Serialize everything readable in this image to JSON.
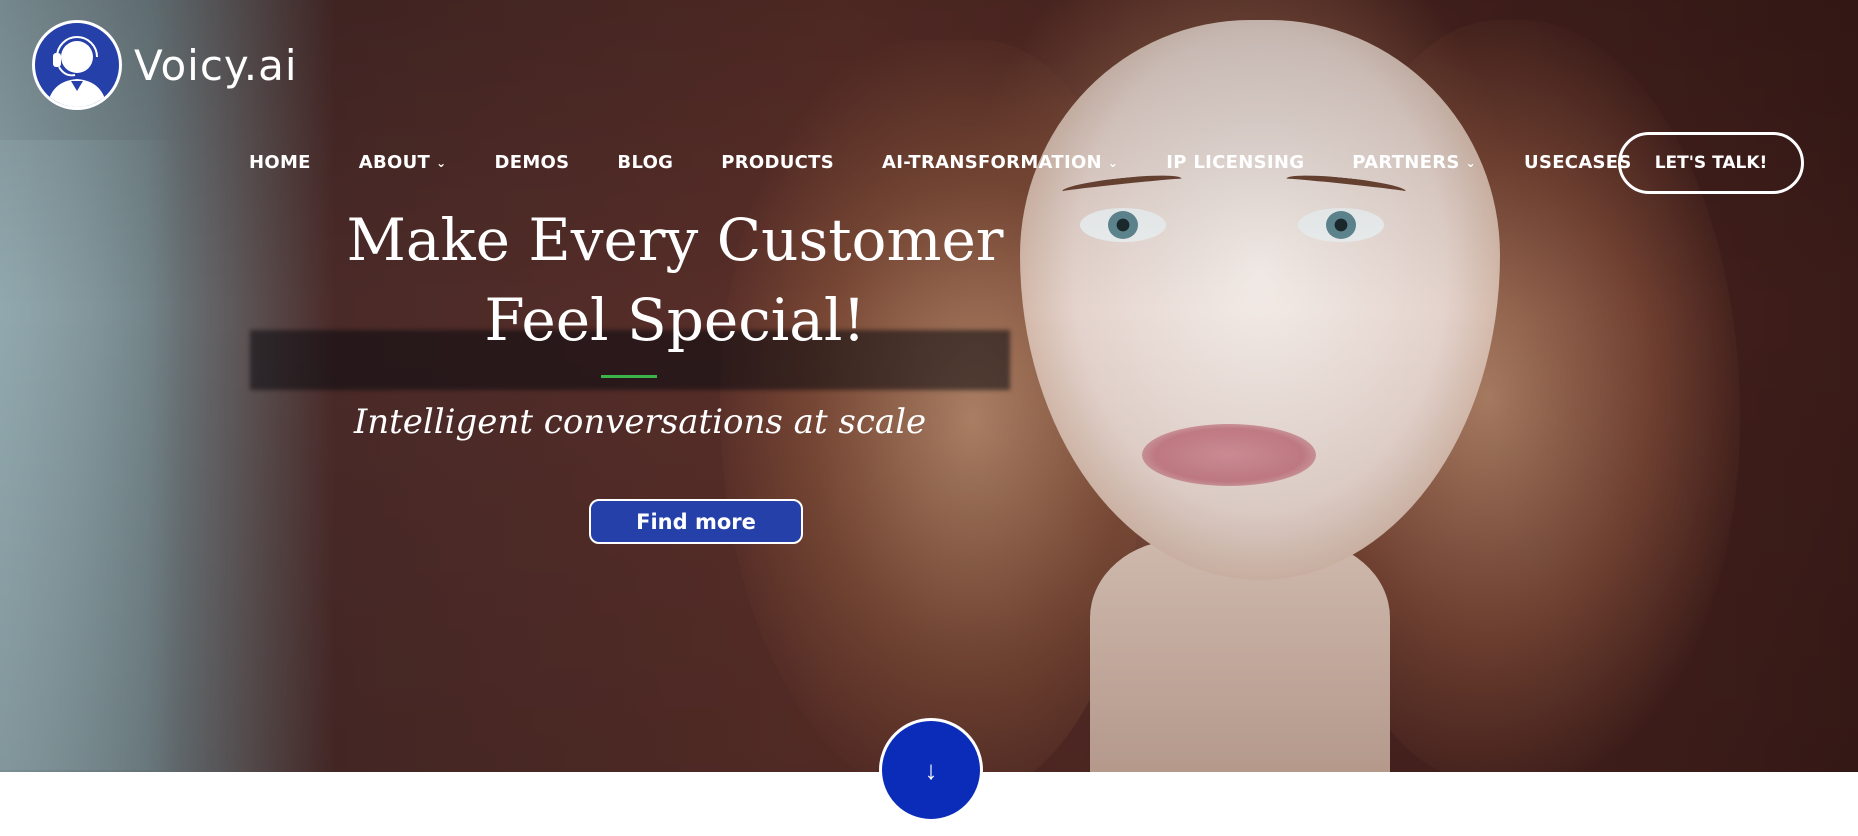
{
  "brand": {
    "name": "Voicy.ai",
    "logo_icon": "support-agent-headset-icon",
    "color": "#2540a8"
  },
  "nav": {
    "items": [
      {
        "label": "HOME",
        "has_dropdown": false
      },
      {
        "label": "ABOUT",
        "has_dropdown": true
      },
      {
        "label": "DEMOS",
        "has_dropdown": false
      },
      {
        "label": "BLOG",
        "has_dropdown": false
      },
      {
        "label": "PRODUCTS",
        "has_dropdown": false
      },
      {
        "label": "AI-TRANSFORMATION",
        "has_dropdown": true
      },
      {
        "label": "IP LICENSING",
        "has_dropdown": false
      },
      {
        "label": "PARTNERS",
        "has_dropdown": true
      },
      {
        "label": "USECASES",
        "has_dropdown": false
      }
    ],
    "dropdown_icon": "chevron-down-icon",
    "cta_label": "LET'S TALK!"
  },
  "hero": {
    "headline_line1": "Make Every Customer",
    "headline_line2": "Feel Special!",
    "subtitle": "Intelligent conversations at scale",
    "button_label": "Find more",
    "accent_color": "#39b54a",
    "scroll_icon": "arrow-down-icon",
    "scroll_glyph": "↓"
  }
}
